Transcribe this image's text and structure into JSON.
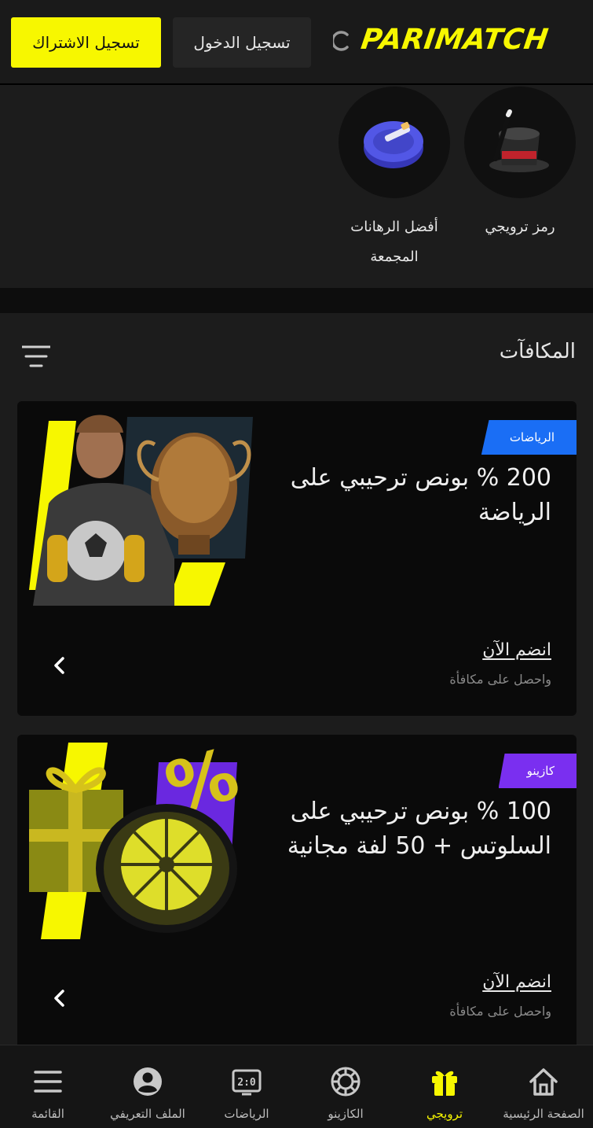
{
  "header": {
    "signup_label": "تسجيل الاشتراك",
    "login_label": "تسجيل الدخول",
    "logo_text": "PARIMATCH",
    "brand_color": "#f7f700"
  },
  "shortcuts": [
    {
      "label": "رمز ترويجي",
      "icon": "magic-hat-icon"
    },
    {
      "label": "أفضل الرهانات المجمعة",
      "icon": "coin-stack-icon"
    }
  ],
  "bonuses": {
    "title": "المكافآت",
    "cards": [
      {
        "tag": "الرياضات",
        "tag_color": "#1a6ef5",
        "title": "200 % بونص ترحيبي على الرياضة",
        "join_label": "انضم الآن",
        "sub_label": "واحصل على مكافأة",
        "image": "footballer-with-trophy"
      },
      {
        "tag": "كازينو",
        "tag_color": "#7a2ff0",
        "title": "100 % بونص ترحيبي على السلوتس + 50 لفة مجانية",
        "join_label": "انضم الآن",
        "sub_label": "واحصل على مكافأة",
        "image": "gift-and-wheel"
      }
    ]
  },
  "bottom_nav": [
    {
      "label": "الصفحة الرئيسية",
      "icon": "home-icon",
      "active": false
    },
    {
      "label": "ترويجي",
      "icon": "gift-icon",
      "active": true
    },
    {
      "label": "الكازينو",
      "icon": "casino-chip-icon",
      "active": false
    },
    {
      "label": "الرياضات",
      "icon": "scoreboard-icon",
      "active": false
    },
    {
      "label": "الملف التعريفي",
      "icon": "user-icon",
      "active": false
    },
    {
      "label": "القائمة",
      "icon": "menu-icon",
      "active": false
    }
  ]
}
